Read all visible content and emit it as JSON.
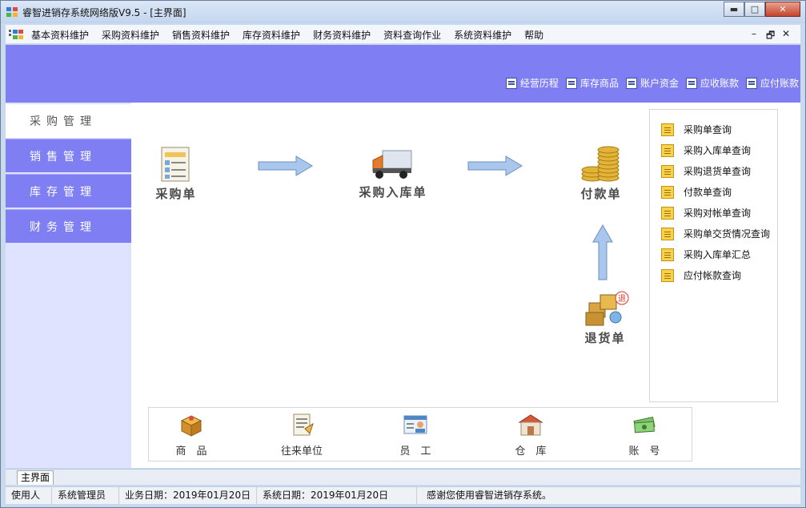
{
  "window": {
    "title": "睿智进销存系统网络版V9.5 - [主界面]",
    "controls": {
      "minimize": "▬",
      "maximize": "□",
      "close": "✕"
    }
  },
  "menu": {
    "items": [
      "基本资料维护",
      "采购资料维护",
      "销售资料维护",
      "库存资料维护",
      "财务资料维护",
      "资料查询作业",
      "系统资料维护",
      "帮助"
    ],
    "mdi_controls": {
      "minimize": "–",
      "restore": "🗗",
      "close": "✕"
    }
  },
  "quick_links": [
    "经营历程",
    "库存商品",
    "账户资金",
    "应收账款",
    "应付账款"
  ],
  "left_nav": [
    {
      "label": "采购管理"
    },
    {
      "label": "销售管理"
    },
    {
      "label": "库存管理"
    },
    {
      "label": "财务管理"
    }
  ],
  "flow": {
    "purchase_order": "采购单",
    "purchase_receipt": "采购入库单",
    "payment": "付款单",
    "return": "退货单"
  },
  "queries": [
    "采购单查询",
    "采购入库单查询",
    "采购退货单查询",
    "付款单查询",
    "采购对帐单查询",
    "采购单交货情况查询",
    "采购入库单汇总",
    "应付帐款查询"
  ],
  "shortcuts": [
    "商　品",
    "往来单位",
    "员　工",
    "仓　库",
    "账　号"
  ],
  "tabs": [
    "主界面"
  ],
  "status": {
    "user_label": "使用人",
    "user_value": "系统管理员",
    "biz_date": "业务日期：2019年01月20日",
    "sys_date": "系统日期：2019年01月20日",
    "message": "感谢您使用睿智进销存系统。"
  },
  "colors": {
    "accent": "#7f7ff3",
    "nav_panel": "#dfe3ff",
    "arrow_fill": "#a9c6ec",
    "coin": "#e2b43a"
  }
}
